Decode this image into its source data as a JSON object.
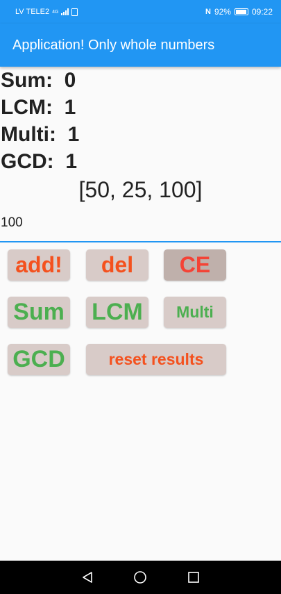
{
  "status_bar": {
    "carrier": "LV TELE2",
    "network": "4G",
    "nfc": "N",
    "battery": "92%",
    "time": "09:22"
  },
  "app_bar": {
    "title": "Application! Only whole numbers"
  },
  "results": {
    "sum": "Sum:  0",
    "lcm": "LCM:  1",
    "multi": "Multi:  1",
    "gcd": "GCD:  1"
  },
  "number_list": "[50, 25, 100]",
  "input": {
    "value": "100"
  },
  "buttons": {
    "add": "add!",
    "del": "del",
    "ce": "CE",
    "sum": "Sum",
    "lcm": "LCM",
    "multi": "Multi",
    "gcd": "GCD",
    "reset": "reset results"
  },
  "colors": {
    "primary": "#2196f3",
    "action_text": "#f4511e",
    "compute_text": "#4caf50",
    "button_bg": "#d8cbc8"
  },
  "nav_icons": [
    "back-icon",
    "home-icon",
    "recents-icon"
  ]
}
